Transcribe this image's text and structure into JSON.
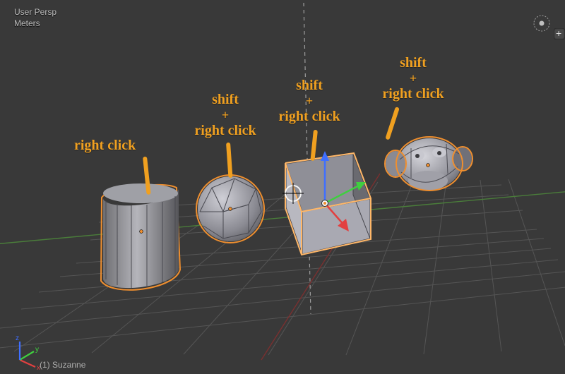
{
  "header": {
    "view_mode": "User Persp",
    "units": "Meters"
  },
  "scene": {
    "active_object_label": "(1) Suzanne"
  },
  "annotations": {
    "cylinder": {
      "label": "right click"
    },
    "sphere": {
      "line1": "shift",
      "line2": "+",
      "line3": "right click"
    },
    "cube": {
      "line1": "shift",
      "line2": "+",
      "line3": "right click"
    },
    "suzanne": {
      "line1": "shift",
      "line2": "+",
      "line3": "right click"
    }
  },
  "axis_gizmo": {
    "x": "x",
    "y": "y",
    "z": "z"
  },
  "cursor": {
    "icon_name": "3d-cursor"
  },
  "gizmo": {
    "x_color": "#e24040",
    "y_color": "#3fcf3f",
    "z_color": "#3f6fff"
  },
  "nav_widget": {
    "icon": "view-rotate-icon"
  }
}
